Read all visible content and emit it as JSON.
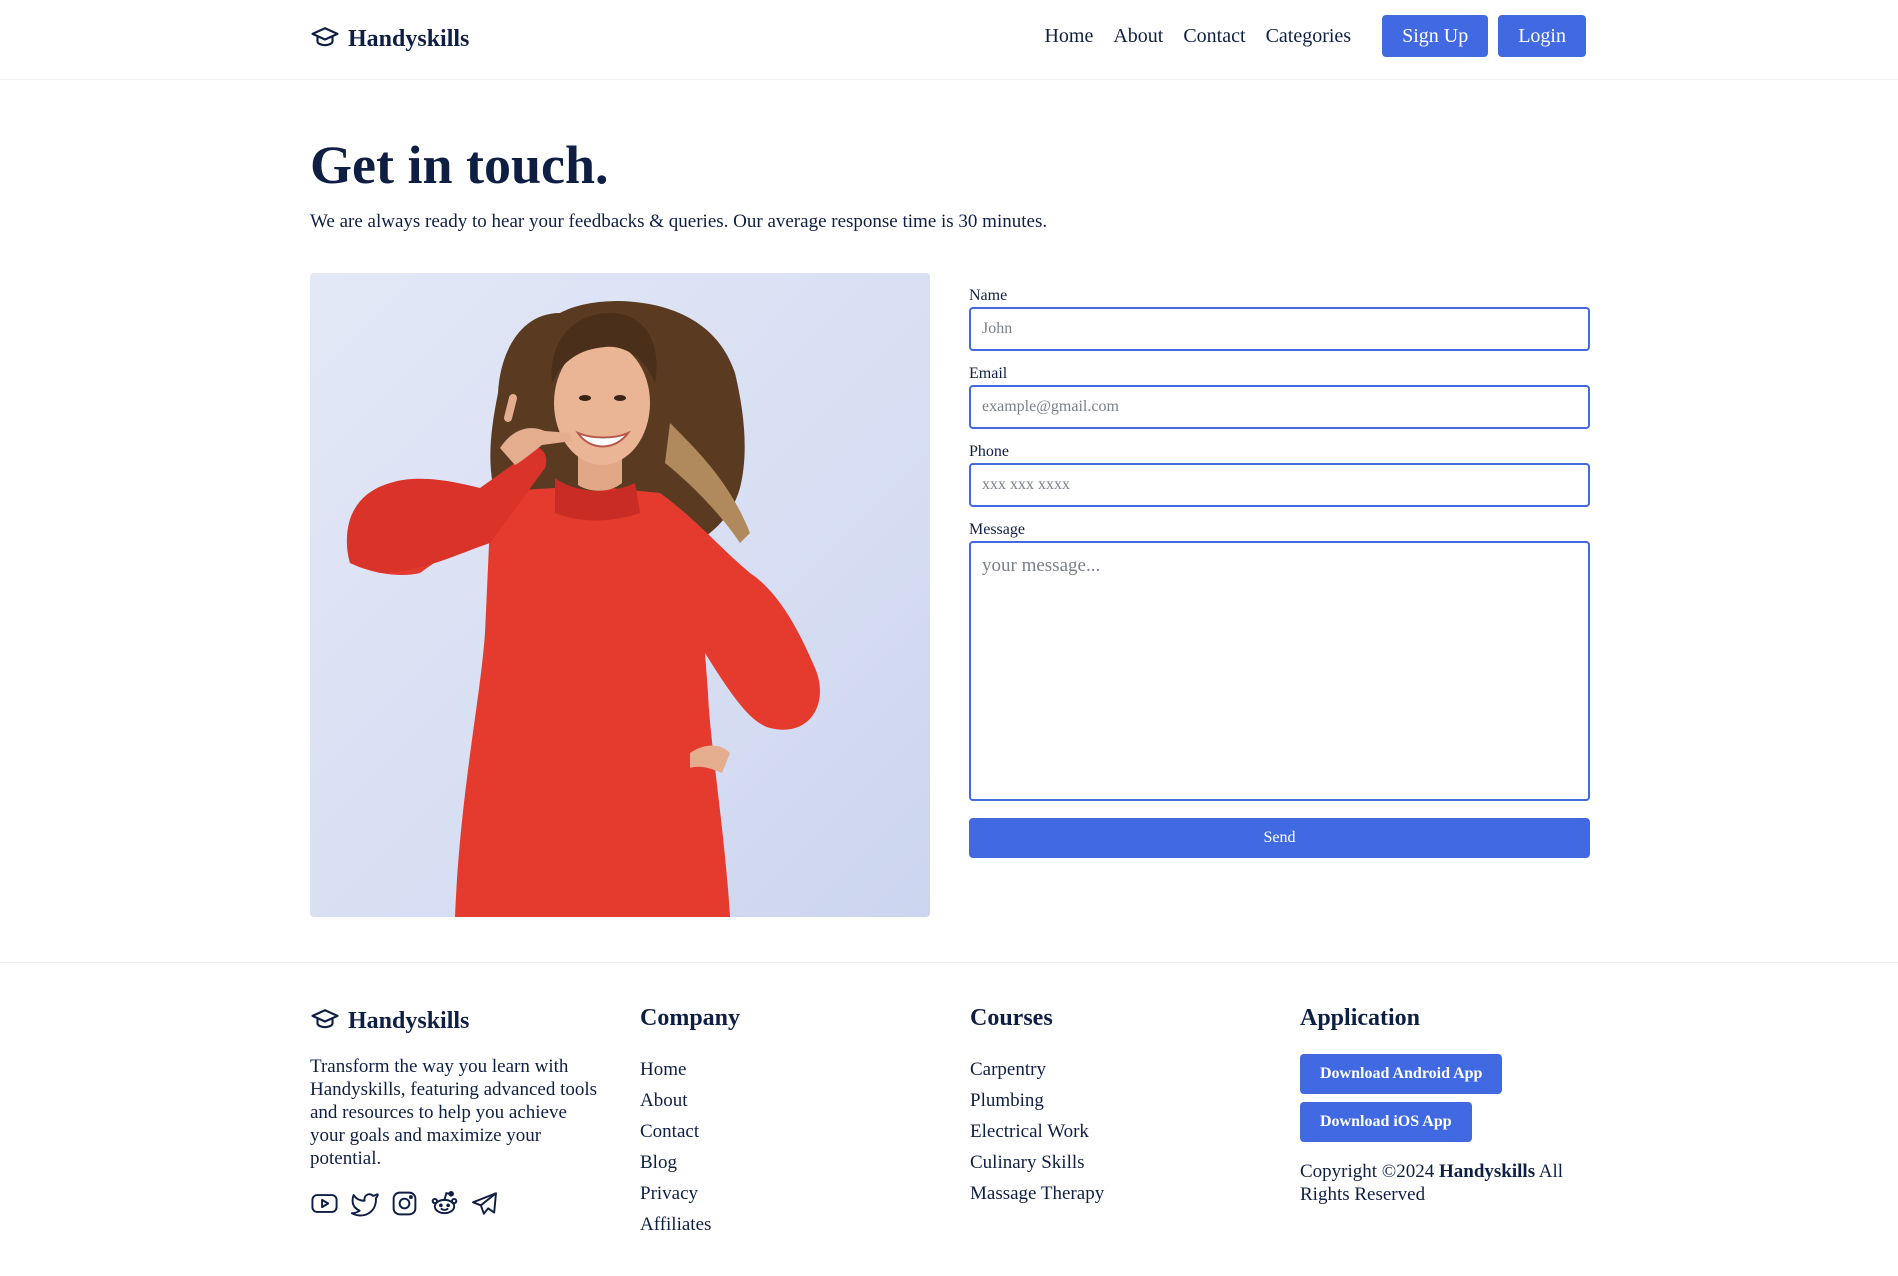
{
  "brand": {
    "name": "Handyskills",
    "icon": "graduation-cap-icon"
  },
  "nav": {
    "links": [
      "Home",
      "About",
      "Contact",
      "Categories"
    ],
    "signup_label": "Sign Up",
    "login_label": "Login"
  },
  "hero": {
    "title": "Get in touch.",
    "subtitle": "We are always ready to hear your feedbacks & queries. Our average response time is 30 minutes."
  },
  "form": {
    "name_label": "Name",
    "name_placeholder": "John",
    "email_label": "Email",
    "email_placeholder": "example@gmail.com",
    "phone_label": "Phone",
    "phone_placeholder": "xxx xxx xxxx",
    "message_label": "Message",
    "message_placeholder": "your message...",
    "send_label": "Send"
  },
  "footer": {
    "description": "Transform the way you learn with Handyskills, featuring advanced tools and resources to help you achieve your goals and maximize your potential.",
    "socials": [
      "youtube-icon",
      "twitter-icon",
      "instagram-icon",
      "reddit-icon",
      "telegram-icon"
    ],
    "company": {
      "title": "Company",
      "links": [
        "Home",
        "About",
        "Contact",
        "Blog",
        "Privacy",
        "Affiliates"
      ]
    },
    "courses": {
      "title": "Courses",
      "links": [
        "Carpentry",
        "Plumbing",
        "Electrical Work",
        "Culinary Skills",
        "Massage Therapy"
      ]
    },
    "application": {
      "title": "Application",
      "android_label": "Download Android App",
      "ios_label": "Download iOS App",
      "copyright_prefix": "Copyright ©2024 ",
      "copyright_brand": "Handyskills",
      "copyright_suffix": " All Rights Reserved"
    }
  },
  "colors": {
    "accent": "#4169e1",
    "text": "#0f1f44",
    "sweater": "#e53a2e",
    "photo_bg": "#dde3f4"
  }
}
